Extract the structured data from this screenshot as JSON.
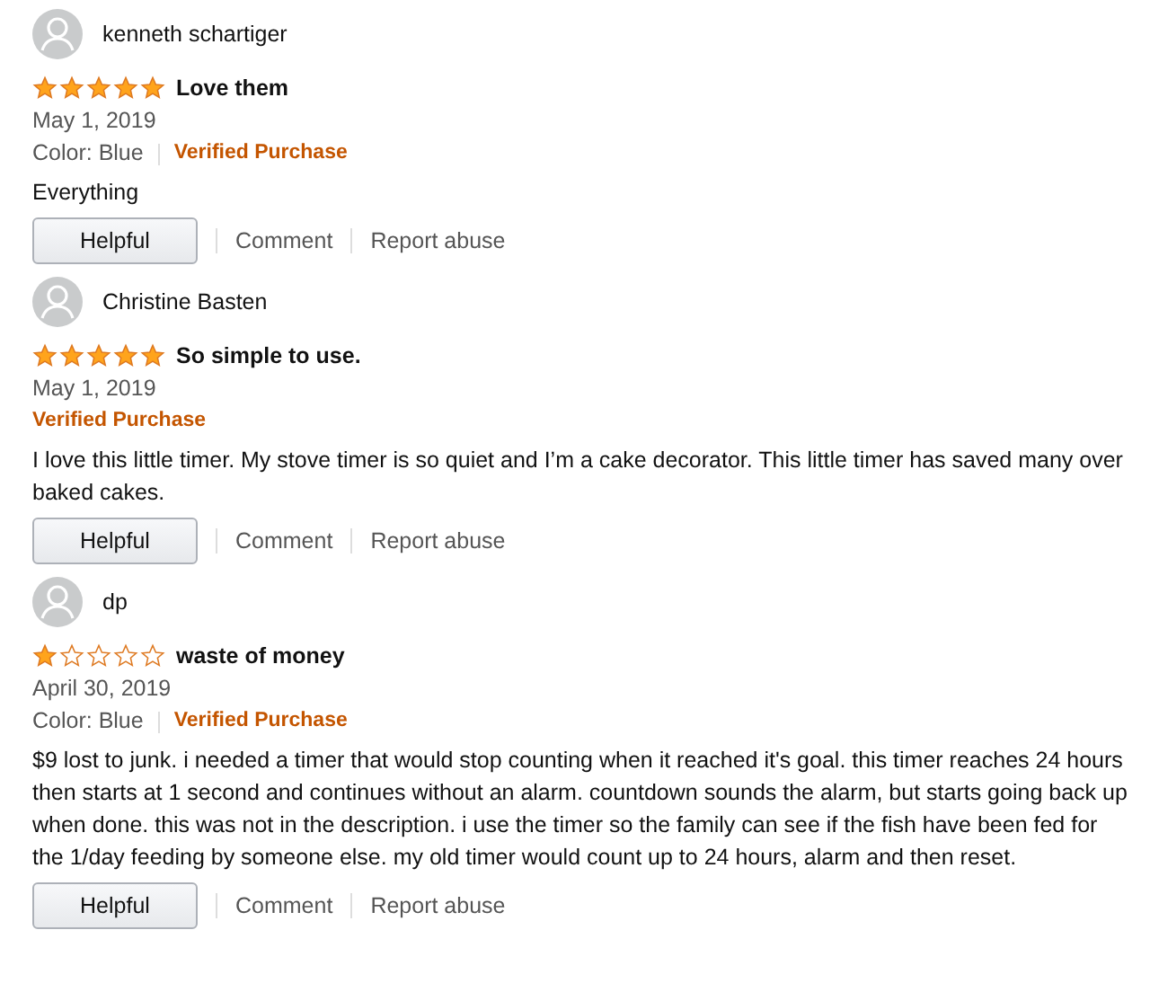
{
  "reviews": [
    {
      "author": "kenneth schartiger",
      "stars": 5,
      "title": "Love them",
      "date": "May 1, 2019",
      "variant": "Color: Blue",
      "badge": "Verified Purchase",
      "body": "Everything",
      "actions": {
        "helpful": "Helpful",
        "comment": "Comment",
        "report": "Report abuse"
      }
    },
    {
      "author": "Christine Basten",
      "stars": 5,
      "title": "So simple to use.",
      "date": "May 1, 2019",
      "badge": "Verified Purchase",
      "body": "I love this little timer. My stove timer is so quiet and I’m a cake decorator. This little timer has saved many over baked cakes.",
      "actions": {
        "helpful": "Helpful",
        "comment": "Comment",
        "report": "Report abuse"
      }
    },
    {
      "author": "dp",
      "stars": 1,
      "title": "waste of money",
      "date": "April 30, 2019",
      "variant": "Color: Blue",
      "badge": "Verified Purchase",
      "body": "$9 lost to junk. i needed a timer that would stop counting when it reached it's goal. this timer reaches 24 hours then starts at 1 second and continues without an alarm. countdown sounds the alarm, but starts going back up when done. this was not in the description. i use the timer so the family can see if the fish have been fed for the 1/day feeding by someone else. my old timer would count up to 24 hours, alarm and then reset.",
      "actions": {
        "helpful": "Helpful",
        "comment": "Comment",
        "report": "Report abuse"
      }
    }
  ]
}
